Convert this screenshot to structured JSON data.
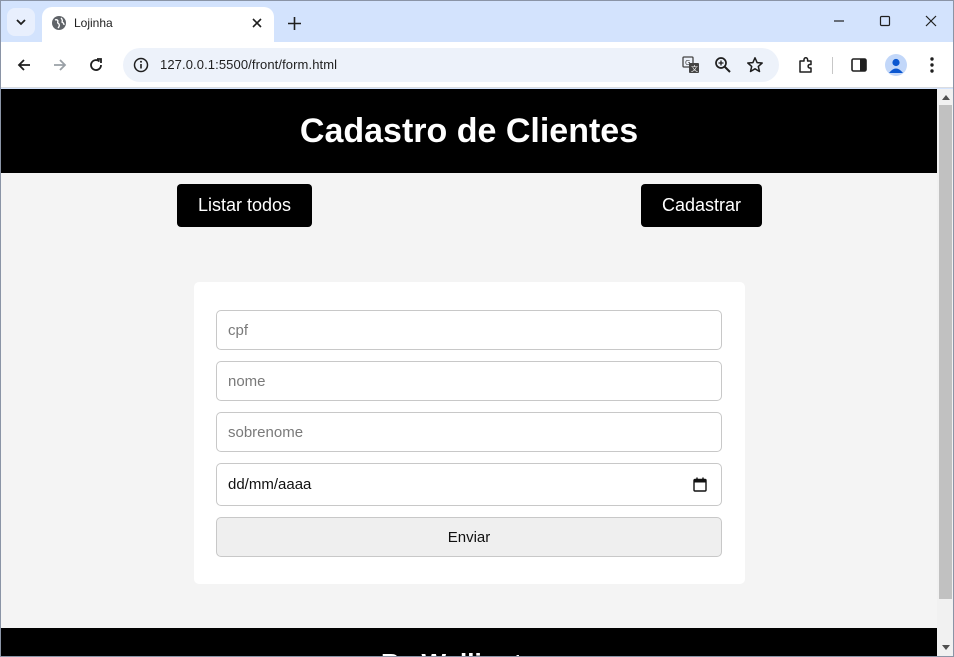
{
  "browser": {
    "tab": {
      "title": "Lojinha",
      "favicon": "globe-icon"
    },
    "address_bar": {
      "url": "127.0.0.1:5500/front/form.html"
    },
    "icons": [
      "tab-search-icon",
      "close-icon",
      "new-tab-icon",
      "minimize-icon",
      "maximize-icon",
      "close-window-icon",
      "back-icon",
      "forward-icon",
      "reload-icon",
      "site-info-icon",
      "translate-icon",
      "zoom-icon",
      "bookmark-star-icon",
      "extensions-icon",
      "side-panel-icon",
      "profile-avatar-icon",
      "menu-kebab-icon"
    ]
  },
  "page": {
    "header": {
      "title": "Cadastro de Clientes"
    },
    "nav": {
      "list_all_label": "Listar todos",
      "register_label": "Cadastrar"
    },
    "form": {
      "cpf_placeholder": "cpf",
      "nome_placeholder": "nome",
      "sobrenome_placeholder": "sobrenome",
      "date_value": "dd/mm/aaaa",
      "submit_label": "Enviar"
    },
    "footer": {
      "text": "By Wellington"
    }
  },
  "colors": {
    "header_bg": "#000000",
    "page_bg": "#f4f4f4",
    "button_bg": "#000000",
    "button_text": "#ffffff",
    "chrome_tabstrip": "#d3e3fd"
  }
}
